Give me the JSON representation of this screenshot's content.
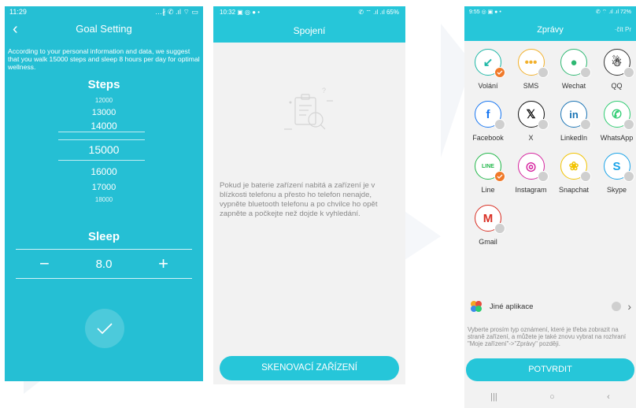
{
  "screen1": {
    "status_time": "11:29",
    "status_icons": "…∦ ✆ .ıl ⌔ ▭",
    "title": "Goal Setting",
    "intro": "According to your personal information and data, we suggest that you walk 15000 steps and sleep 8 hours per day for optimal wellness.",
    "steps_label": "Steps",
    "step_options": [
      "12000",
      "13000",
      "14000",
      "15000",
      "16000",
      "17000",
      "18000"
    ],
    "sleep_label": "Sleep",
    "minus": "−",
    "sleep_value": "8.0",
    "plus": "+"
  },
  "screen2": {
    "status_left": "10:32 ▣ ◎ ● •",
    "status_right": "✆ ⌔ .ıl .ıl 65%",
    "title": "Spojení",
    "message": "Pokud je baterie zařízení nabitá a zařízení je v blízkosti telefonu a přesto ho telefon nenajde, vypněte bluetooth telefonu a po chvilce ho opět zapněte a počkejte než dojde k vyhledání.",
    "scan_button": "SKENOVACÍ ZAŘÍZENÍ"
  },
  "screen3": {
    "status_left": "9:55 ◎ ▣ ● •",
    "status_right": "✆ ⌔ .ıl .ıl 72%",
    "title": "Zprávy",
    "header_right": "·čít  Pr",
    "apps": [
      {
        "label": "Volání",
        "icon": "phone-call-icon",
        "color": "#1fb8a7",
        "checked": true
      },
      {
        "label": "SMS",
        "icon": "sms-icon",
        "color": "#f2b02a",
        "checked": false
      },
      {
        "label": "Wechat",
        "icon": "wechat-icon",
        "color": "#2eb872",
        "checked": false
      },
      {
        "label": "QQ",
        "icon": "qq-penguin-icon",
        "color": "#333333",
        "checked": false
      },
      {
        "label": "Facebook",
        "icon": "facebook-icon",
        "color": "#1877f2",
        "checked": false
      },
      {
        "label": "X",
        "icon": "x-icon",
        "color": "#111111",
        "checked": false
      },
      {
        "label": "LinkedIn",
        "icon": "linkedin-icon",
        "color": "#1a74b5",
        "checked": false
      },
      {
        "label": "WhatsApp",
        "icon": "whatsapp-icon",
        "color": "#2ecc71",
        "checked": false
      },
      {
        "label": "Line",
        "icon": "line-icon",
        "color": "#23b84b",
        "checked": true
      },
      {
        "label": "Instagram",
        "icon": "instagram-icon",
        "color": "#d6249f",
        "checked": false
      },
      {
        "label": "Snapchat",
        "icon": "snapchat-icon",
        "color": "#f2c300",
        "checked": false
      },
      {
        "label": "Skype",
        "icon": "skype-icon",
        "color": "#1aa3e8",
        "checked": false
      },
      {
        "label": "Gmail",
        "icon": "gmail-icon",
        "color": "#d93025",
        "checked": false
      }
    ],
    "other_apps": "Jiné aplikace",
    "note": "Vyberte prosím typ oznámení, které je třeba zobrazit na straně zařízení, a můžete je také znovu vybrat na rozhraní \"Moje zařízení\"->\"Zprávy\" později.",
    "confirm_button": "POTVRDIT",
    "nav": [
      "|||",
      "○",
      "‹"
    ]
  },
  "colors": {
    "accent": "#26c6d9",
    "screen1_bg": "#25bfd4",
    "check_badge": "#f07a2a"
  }
}
